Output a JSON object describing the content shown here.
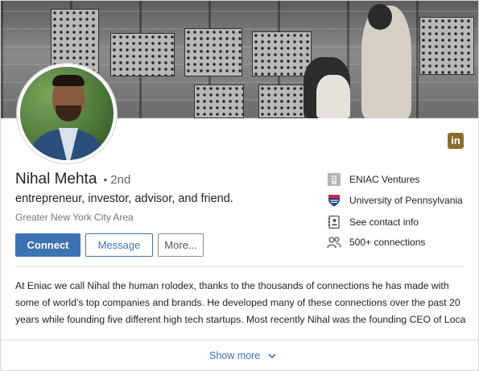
{
  "profile": {
    "name": "Nihal Mehta",
    "separator": "•",
    "degree": "2nd",
    "headline": "entrepreneur, investor, advisor, and friend.",
    "location": "Greater New York City Area"
  },
  "actions": {
    "connect": "Connect",
    "message": "Message",
    "more": "More..."
  },
  "badge": {
    "label": "in",
    "color": "#8a6d2e"
  },
  "side_items": [
    {
      "label": "ENIAC Ventures",
      "icon": "company-icon"
    },
    {
      "label": "University of Pennsylvania",
      "icon": "university-shield-icon"
    },
    {
      "label": "See contact info",
      "icon": "contact-card-icon"
    },
    {
      "label": "500+ connections",
      "icon": "people-icon"
    }
  ],
  "about": {
    "lines": [
      "At Eniac we call Nihal the human rolodex, thanks to the thousands of connections he has made with",
      "some of world’s top companies and brands. He developed many of these connections over the past 20",
      "years while founding five different high tech startups. Most recently Nihal was the founding CEO of Loca..."
    ]
  },
  "show_more": "Show more",
  "colors": {
    "accent": "#3c73b4",
    "badge": "#8a6d2e"
  }
}
